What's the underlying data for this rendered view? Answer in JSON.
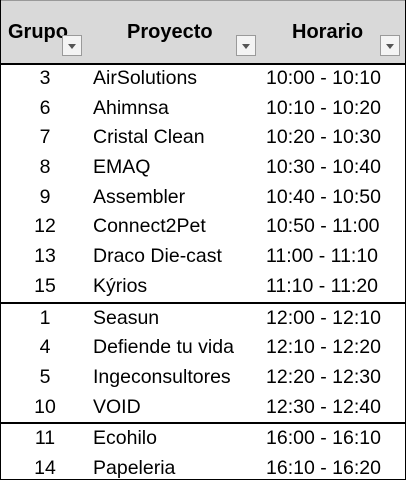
{
  "columns": {
    "grupo": "Grupo",
    "proyecto": "Proyecto",
    "horario": "Horario"
  },
  "rows": [
    {
      "grupo": "3",
      "proyecto": "AirSolutions",
      "horario": "10:00 - 10:10"
    },
    {
      "grupo": "6",
      "proyecto": "Ahimnsa",
      "horario": "10:10 - 10:20"
    },
    {
      "grupo": "7",
      "proyecto": "Cristal Clean",
      "horario": "10:20 - 10:30"
    },
    {
      "grupo": "8",
      "proyecto": "EMAQ",
      "horario": "10:30 - 10:40"
    },
    {
      "grupo": "9",
      "proyecto": "Assembler",
      "horario": "10:40 - 10:50"
    },
    {
      "grupo": "12",
      "proyecto": "Connect2Pet",
      "horario": "10:50 - 11:00"
    },
    {
      "grupo": "13",
      "proyecto": "Draco Die-cast",
      "horario": "11:00 - 11:10"
    },
    {
      "grupo": "15",
      "proyecto": "Kýrios",
      "horario": "11:10 - 11:20"
    },
    {
      "grupo": "1",
      "proyecto": "Seasun",
      "horario": "12:00 - 12:10"
    },
    {
      "grupo": "4",
      "proyecto": "Defiende tu vida",
      "horario": "12:10 - 12:20"
    },
    {
      "grupo": "5",
      "proyecto": "Ingeconsultores",
      "horario": "12:20 - 12:30"
    },
    {
      "grupo": "10",
      "proyecto": "VOID",
      "horario": "12:30 - 12:40"
    },
    {
      "grupo": "11",
      "proyecto": "Ecohilo",
      "horario": "16:00 - 16:10"
    },
    {
      "grupo": "14",
      "proyecto": "Papeleria",
      "horario": "16:10 - 16:20"
    }
  ],
  "icons": {
    "filter": "filter-dropdown-icon"
  }
}
